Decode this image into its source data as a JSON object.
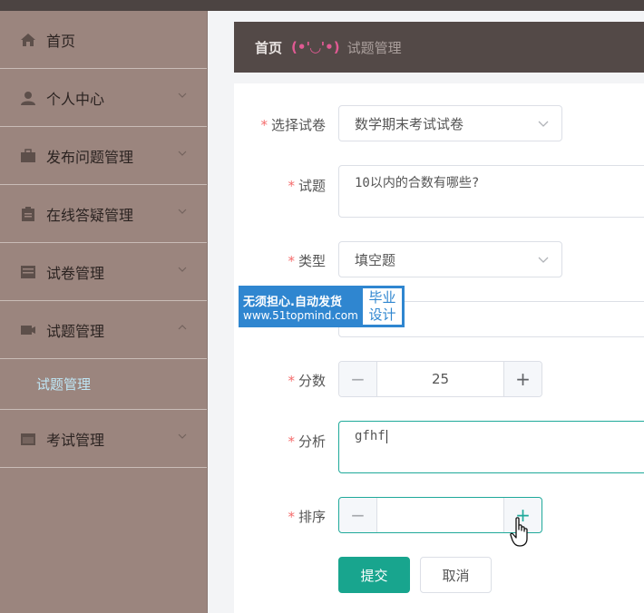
{
  "sidebar": {
    "items": [
      {
        "label": "首页",
        "icon": "home-icon"
      },
      {
        "label": "个人中心",
        "icon": "user-icon"
      },
      {
        "label": "发布问题管理",
        "icon": "briefcase-icon"
      },
      {
        "label": "在线答疑管理",
        "icon": "clipboard-icon"
      },
      {
        "label": "试卷管理",
        "icon": "grid-icon"
      },
      {
        "label": "试题管理",
        "icon": "video-icon"
      },
      {
        "label": "试题管理",
        "icon": "none"
      },
      {
        "label": "考试管理",
        "icon": "calendar-icon"
      }
    ]
  },
  "breadcrumb": {
    "home": "首页",
    "separator": "(•'◡'•)",
    "current": "试题管理"
  },
  "form": {
    "exam_label": "选择试卷",
    "exam_value": "数学期末考试试卷",
    "question_label": "试题",
    "question_value": "10以内的合数有哪些?",
    "type_label": "类型",
    "type_value": "填空题",
    "score_label": "分数",
    "score_value": "25",
    "analysis_label": "分析",
    "analysis_value": "gfhf",
    "order_label": "排序",
    "order_value": "",
    "stepper_minus": "−",
    "stepper_plus": "+",
    "submit_label": "提交",
    "cancel_label": "取消"
  },
  "watermark": {
    "line1": "无须担心.自动发货",
    "line2": "www.51topmind.com",
    "badge_line1": "毕业",
    "badge_line2": "设计"
  },
  "colors": {
    "sidebar_bg": "#9b857e",
    "accent": "#18a58e",
    "required_star": "#f56c6c",
    "breadcrumb_bg": "#534947"
  }
}
